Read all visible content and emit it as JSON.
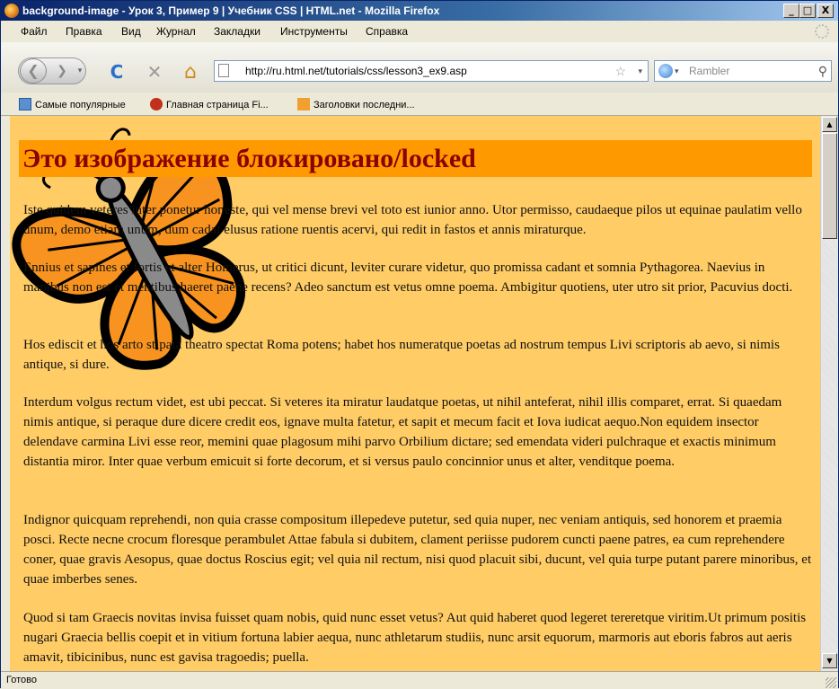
{
  "window": {
    "title": "background-image - Урок 3, Пример 9 | Учебник CSS | HTML.net - Mozilla Firefox",
    "controls": {
      "minimize": "_",
      "maximize": "□",
      "close": "X"
    }
  },
  "menubar": {
    "items": [
      {
        "label": "Файл",
        "icon": ""
      },
      {
        "label": "Правка"
      },
      {
        "label": "Вид"
      },
      {
        "label": "Журнал"
      },
      {
        "label": "Закладки"
      },
      {
        "label": "Инструменты"
      },
      {
        "label": "Справка"
      }
    ]
  },
  "navbar": {
    "back_icon": "back-arrow-icon",
    "forward_icon": "forward-arrow-icon",
    "reload_glyph": "C",
    "stop_glyph": "✕",
    "home_glyph": "⌂",
    "url": "http://ru.html.net/tutorials/css/lesson3_ex9.asp",
    "star_glyph": "☆",
    "search_placeholder": "Rambler",
    "search_glyph": "⚲",
    "dropdown_glyph": "▾"
  },
  "bookmarks": [
    {
      "label": "Самые популярные",
      "icon": "bookmarks-folder-icon"
    },
    {
      "label": "Главная страница Fi...",
      "icon": "firefox-page-icon"
    },
    {
      "label": "Заголовки последни...",
      "icon": "rss-feed-icon"
    }
  ],
  "page": {
    "heading": "Это изображение блокировано/locked",
    "background_color": "#ffcc66",
    "heading_background": "#ff9900",
    "heading_color": "#8b0000",
    "paragraphs": [
      "Iste quidem veteres inter ponetur honeste, qui vel mense brevi vel toto est iunior anno. Utor permisso, caudaeque pilos ut equinae paulatim vello unum, demo etiam unum, dum cadat elusus ratione ruentis acervi, qui redit in fastos et annis miraturque.",
      "Ennius et sapines et fortis et alter Homerus, ut critici dicunt, leviter curare videtur, quo promissa cadant et somnia Pythagorea. Naevius in manibus non est et mentibus haeret paene recens? Adeo sanctum est vetus omne poema. Ambigitur quotiens, uter utro sit prior, Pacuvius docti.",
      "Hos ediscit et hos arto stipata theatro spectat Roma potens; habet hos numeratque poetas ad nostrum tempus Livi scriptoris ab aevo, si nimis antique, si dure.",
      "Interdum volgus rectum videt, est ubi peccat. Si veteres ita miratur laudatque poetas, ut nihil anteferat, nihil illis comparet, errat. Si quaedam nimis antique, si peraque dure dicere credit eos, ignave multa fatetur, et sapit et mecum facit et Iova iudicat aequo.Non equidem insector delendave carmina Livi esse reor, memini quae plagosum mihi parvo Orbilium dictare; sed emendata videri pulchraque et exactis minimum distantia miror. Inter quae verbum emicuit si forte decorum, et si versus paulo concinnior unus et alter, venditque poema.",
      "Indignor quicquam reprehendi, non quia crasse compositum illepedeve putetur, sed quia nuper, nec veniam antiquis, sed honorem et praemia posci. Recte necne crocum floresque perambulet Attae fabula si dubitem, clament periisse pudorem cuncti paene patres, ea cum reprehendere coner, quae gravis Aesopus, quae doctus Roscius egit; vel quia nil rectum, nisi quod placuit sibi, ducunt, vel quia turpe putant parere minoribus, et quae imberbes senes.",
      "Quod si tam Graecis novitas invisa fuisset quam nobis, quid nunc esset vetus? Aut quid haberet quod legeret tereretque viritim.Ut primum positis nugari Graecia bellis coepit et in vitium fortuna labier aequa, nunc athletarum studiis, nunc arsit equorum, marmoris aut eboris fabros aut aeris amavit, tibicinibus, nunc est gavisa tragoedis; puella."
    ],
    "background_image": "butterfly-background-image"
  },
  "scrollbar": {
    "up_glyph": "▲",
    "down_glyph": "▼"
  },
  "statusbar": {
    "text": "Готово"
  }
}
